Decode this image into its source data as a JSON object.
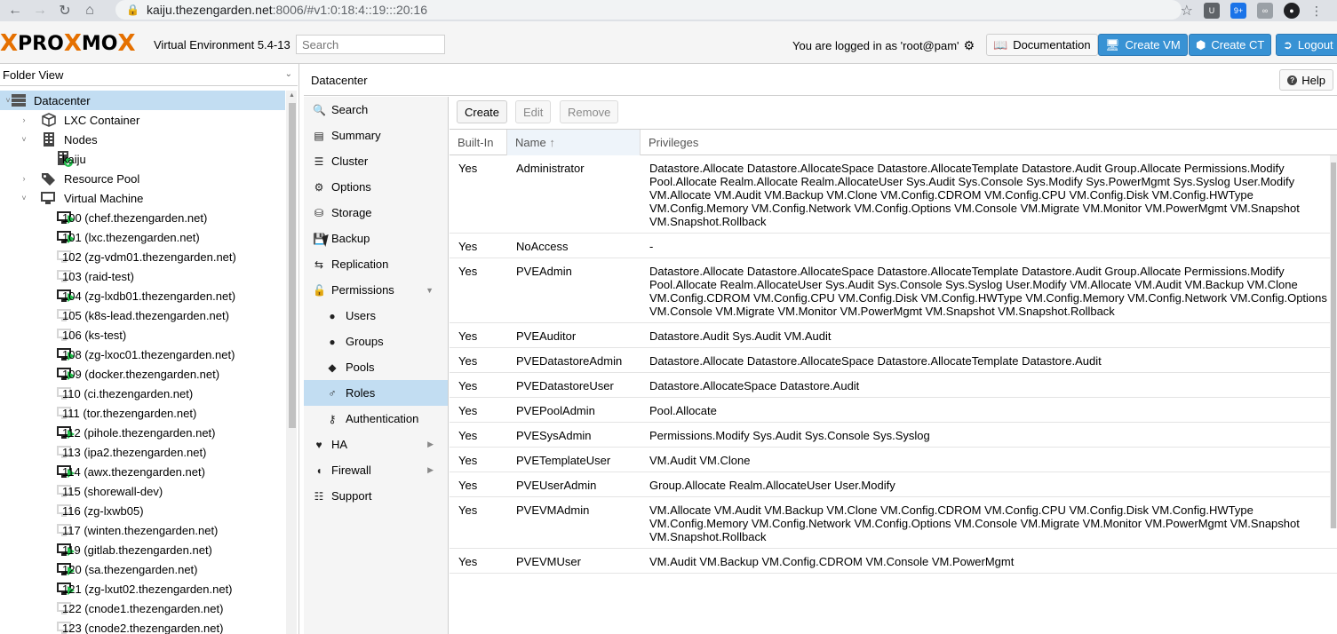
{
  "browser": {
    "url_host": "kaiju.thezengarden.net",
    "url_rest": ":8006/#v1:0:18:4::19:::20:16",
    "badge": "9+"
  },
  "header": {
    "product": "PROXMOX",
    "version": "Virtual Environment 5.4-13",
    "search_placeholder": "Search",
    "login_text": "You are logged in as 'root@pam'",
    "documentation": "Documentation",
    "create_vm": "Create VM",
    "create_ct": "Create CT",
    "logout": "Logout"
  },
  "tree": {
    "view": "Folder View",
    "items": [
      {
        "label": "Datacenter"
      },
      {
        "label": "LXC Container"
      },
      {
        "label": "Nodes"
      },
      {
        "label": "kaiju"
      },
      {
        "label": "Resource Pool"
      },
      {
        "label": "Virtual Machine"
      },
      {
        "label": "100 (chef.thezengarden.net)",
        "running": true
      },
      {
        "label": "101 (lxc.thezengarden.net)",
        "running": true
      },
      {
        "label": "102 (zg-vdm01.thezengarden.net)",
        "running": false
      },
      {
        "label": "103 (raid-test)",
        "running": false
      },
      {
        "label": "104 (zg-lxdb01.thezengarden.net)",
        "running": true
      },
      {
        "label": "105 (k8s-lead.thezengarden.net)",
        "running": false
      },
      {
        "label": "106 (ks-test)",
        "running": false
      },
      {
        "label": "108 (zg-lxoc01.thezengarden.net)",
        "running": true
      },
      {
        "label": "109 (docker.thezengarden.net)",
        "running": true
      },
      {
        "label": "110 (ci.thezengarden.net)",
        "running": false
      },
      {
        "label": "111 (tor.thezengarden.net)",
        "running": false
      },
      {
        "label": "112 (pihole.thezengarden.net)",
        "running": true
      },
      {
        "label": "113 (ipa2.thezengarden.net)",
        "running": false
      },
      {
        "label": "114 (awx.thezengarden.net)",
        "running": true
      },
      {
        "label": "115 (shorewall-dev)",
        "running": false
      },
      {
        "label": "116 (zg-lxwb05)",
        "running": false
      },
      {
        "label": "117 (winten.thezengarden.net)",
        "running": false
      },
      {
        "label": "119 (gitlab.thezengarden.net)",
        "running": true
      },
      {
        "label": "120 (sa.thezengarden.net)",
        "running": true
      },
      {
        "label": "121 (zg-lxut02.thezengarden.net)",
        "running": true
      },
      {
        "label": "122 (cnode1.thezengarden.net)",
        "running": false
      },
      {
        "label": "123 (cnode2.thezengarden.net)",
        "running": false
      }
    ]
  },
  "content": {
    "title": "Datacenter",
    "help": "Help",
    "menu": [
      {
        "label": "Search",
        "icon": "search-icon"
      },
      {
        "label": "Summary",
        "icon": "book-icon"
      },
      {
        "label": "Cluster",
        "icon": "server-icon"
      },
      {
        "label": "Options",
        "icon": "gear-icon"
      },
      {
        "label": "Storage",
        "icon": "database-icon"
      },
      {
        "label": "Backup",
        "icon": "floppy-icon"
      },
      {
        "label": "Replication",
        "icon": "retweet-icon"
      },
      {
        "label": "Permissions",
        "icon": "unlock-icon"
      },
      {
        "label": "Users",
        "icon": "user-icon"
      },
      {
        "label": "Groups",
        "icon": "users-icon"
      },
      {
        "label": "Pools",
        "icon": "tags-icon"
      },
      {
        "label": "Roles",
        "icon": "male-icon"
      },
      {
        "label": "Authentication",
        "icon": "key-icon"
      },
      {
        "label": "HA",
        "icon": "heartbeat-icon"
      },
      {
        "label": "Firewall",
        "icon": "shield-icon"
      },
      {
        "label": "Support",
        "icon": "comments-icon"
      }
    ],
    "toolbar": {
      "create": "Create",
      "edit": "Edit",
      "remove": "Remove"
    },
    "columns": {
      "builtin": "Built-In",
      "name": "Name",
      "sort_arrow": "↑",
      "privileges": "Privileges"
    },
    "roles": [
      {
        "builtin": "Yes",
        "name": "Administrator",
        "privs": "Datastore.Allocate Datastore.AllocateSpace Datastore.AllocateTemplate Datastore.Audit Group.Allocate Permissions.Modify Pool.Allocate Realm.Allocate Realm.AllocateUser Sys.Audit Sys.Console Sys.Modify Sys.PowerMgmt Sys.Syslog User.Modify VM.Allocate VM.Audit VM.Backup VM.Clone VM.Config.CDROM VM.Config.CPU VM.Config.Disk VM.Config.HWType VM.Config.Memory VM.Config.Network VM.Config.Options VM.Console VM.Migrate VM.Monitor VM.PowerMgmt VM.Snapshot VM.Snapshot.Rollback"
      },
      {
        "builtin": "Yes",
        "name": "NoAccess",
        "privs": "-"
      },
      {
        "builtin": "Yes",
        "name": "PVEAdmin",
        "privs": "Datastore.Allocate Datastore.AllocateSpace Datastore.AllocateTemplate Datastore.Audit Group.Allocate Permissions.Modify Pool.Allocate Realm.AllocateUser Sys.Audit Sys.Console Sys.Syslog User.Modify VM.Allocate VM.Audit VM.Backup VM.Clone VM.Config.CDROM VM.Config.CPU VM.Config.Disk VM.Config.HWType VM.Config.Memory VM.Config.Network VM.Config.Options VM.Console VM.Migrate VM.Monitor VM.PowerMgmt VM.Snapshot VM.Snapshot.Rollback"
      },
      {
        "builtin": "Yes",
        "name": "PVEAuditor",
        "privs": "Datastore.Audit Sys.Audit VM.Audit"
      },
      {
        "builtin": "Yes",
        "name": "PVEDatastoreAdmin",
        "privs": "Datastore.Allocate Datastore.AllocateSpace Datastore.AllocateTemplate Datastore.Audit"
      },
      {
        "builtin": "Yes",
        "name": "PVEDatastoreUser",
        "privs": "Datastore.AllocateSpace Datastore.Audit"
      },
      {
        "builtin": "Yes",
        "name": "PVEPoolAdmin",
        "privs": "Pool.Allocate"
      },
      {
        "builtin": "Yes",
        "name": "PVESysAdmin",
        "privs": "Permissions.Modify Sys.Audit Sys.Console Sys.Syslog"
      },
      {
        "builtin": "Yes",
        "name": "PVETemplateUser",
        "privs": "VM.Audit VM.Clone"
      },
      {
        "builtin": "Yes",
        "name": "PVEUserAdmin",
        "privs": "Group.Allocate Realm.AllocateUser User.Modify"
      },
      {
        "builtin": "Yes",
        "name": "PVEVMAdmin",
        "privs": "VM.Allocate VM.Audit VM.Backup VM.Clone VM.Config.CDROM VM.Config.CPU VM.Config.Disk VM.Config.HWType VM.Config.Memory VM.Config.Network VM.Config.Options VM.Console VM.Migrate VM.Monitor VM.PowerMgmt VM.Snapshot VM.Snapshot.Rollback"
      },
      {
        "builtin": "Yes",
        "name": "PVEVMUser",
        "privs": "VM.Audit VM.Backup VM.Config.CDROM VM.Console VM.PowerMgmt"
      }
    ]
  }
}
